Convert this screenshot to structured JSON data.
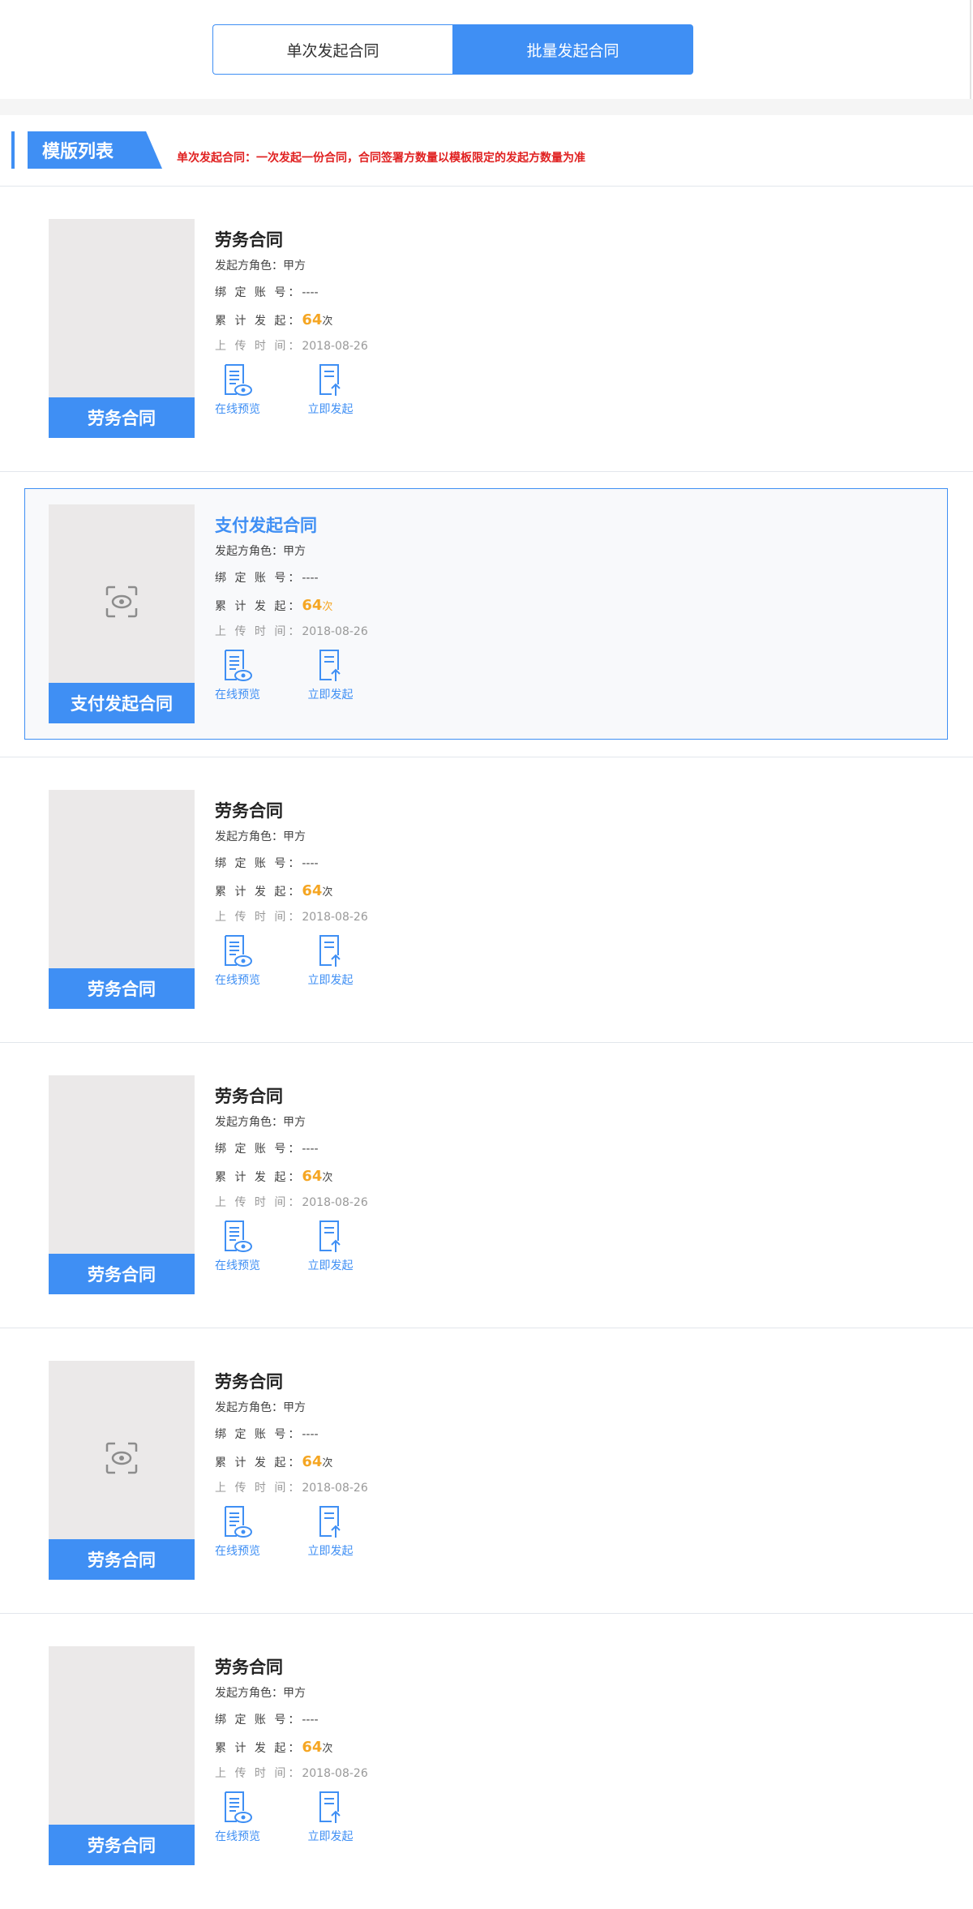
{
  "tabs": {
    "single_label": "单次发起合同",
    "batch_label": "批量发起合同",
    "active": "batch"
  },
  "section": {
    "title": "模版列表",
    "note": "单次发起合同：一次发起一份合同，合同签署方数量以模板限定的发起方数量为准"
  },
  "labels": {
    "role": "发起方角色：",
    "account": "绑 定 账 号：",
    "count": "累 计 发 起：",
    "upload": "上 传 时 间：",
    "preview": "在线预览",
    "launch": "立即发起"
  },
  "templates": [
    {
      "name": "劳务合同",
      "role": "甲方",
      "account": "----",
      "count": "64",
      "count_unit": "次",
      "upload_date": "2018-08-26"
    },
    {
      "name": "支付发起合同",
      "role": "甲方",
      "account": "----",
      "count": "64",
      "count_unit": "次",
      "upload_date": "2018-08-26"
    },
    {
      "name": "劳务合同",
      "role": "甲方",
      "account": "----",
      "count": "64",
      "count_unit": "次",
      "upload_date": "2018-08-26"
    },
    {
      "name": "劳务合同",
      "role": "甲方",
      "account": "----",
      "count": "64",
      "count_unit": "次",
      "upload_date": "2018-08-26"
    },
    {
      "name": "劳务合同",
      "role": "甲方",
      "account": "----",
      "count": "64",
      "count_unit": "次",
      "upload_date": "2018-08-26"
    },
    {
      "name": "劳务合同",
      "role": "甲方",
      "account": "----",
      "count": "64",
      "count_unit": "次",
      "upload_date": "2018-08-26"
    }
  ],
  "colors": {
    "accent": "#3f8ff4",
    "note_red": "#e02020",
    "count_orange": "#f5a623",
    "thumb_bg": "#ebe9e9"
  },
  "icons": {
    "preview": "document-eye-icon",
    "launch": "document-upload-icon",
    "thumb_hover": "eye-scan-icon"
  }
}
